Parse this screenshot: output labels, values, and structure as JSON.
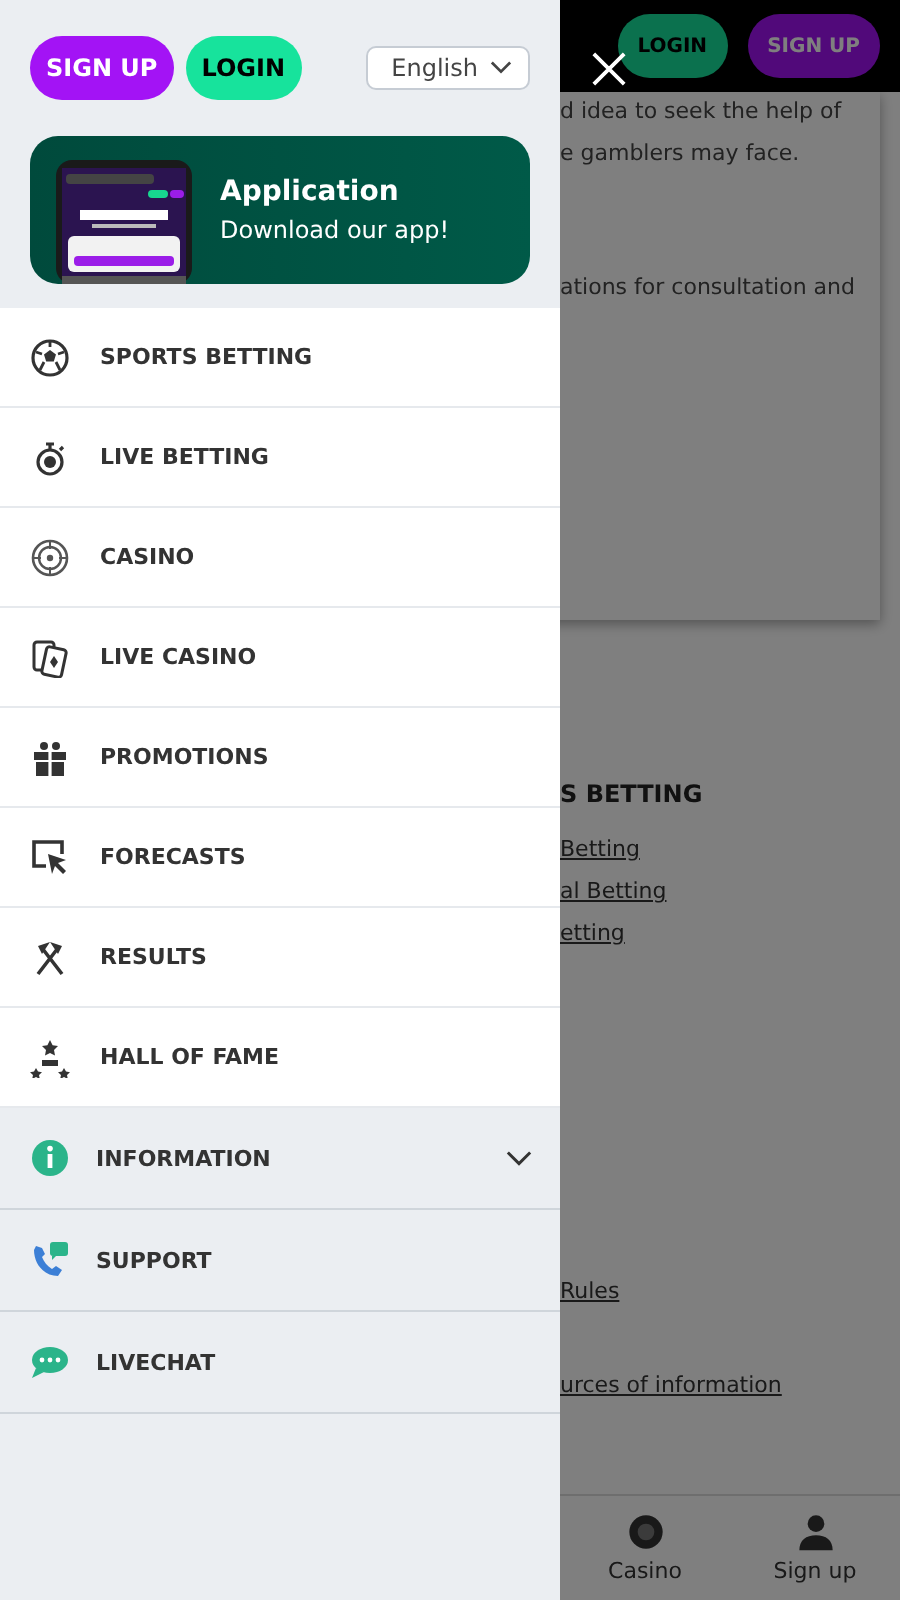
{
  "background_page": {
    "header_buttons": [
      {
        "label": "LOGIN",
        "kind": "login"
      },
      {
        "label": "SIGN UP",
        "kind": "signup"
      }
    ],
    "card_lines": [
      "d idea to seek the help of",
      "e gamblers may face.",
      "ations for consultation and"
    ],
    "section_title": "S BETTING",
    "links": [
      "Betting",
      "al Betting",
      "etting"
    ],
    "lower_links": [
      "Rules",
      "urces of information"
    ],
    "bottom_nav": [
      {
        "label": "Casino",
        "kind": "chip"
      },
      {
        "label": "Sign up",
        "kind": "user"
      }
    ]
  },
  "drawer": {
    "buttons": [
      {
        "label": "SIGN UP",
        "kind": "signup"
      },
      {
        "label": "LOGIN",
        "kind": "login"
      }
    ],
    "language": "English",
    "app_banner": {
      "title": "Application",
      "subtitle": "Download our app!"
    },
    "menu": [
      {
        "label": "SPORTS BETTING",
        "kind": "ball"
      },
      {
        "label": "LIVE BETTING",
        "kind": "stopwatch"
      },
      {
        "label": "CASINO",
        "kind": "roulette"
      },
      {
        "label": "LIVE CASINO",
        "kind": "cards"
      },
      {
        "label": "PROMOTIONS",
        "kind": "gift"
      },
      {
        "label": "FORECASTS",
        "kind": "cursor"
      },
      {
        "label": "RESULTS",
        "kind": "hammers"
      },
      {
        "label": "HALL OF FAME",
        "kind": "podium"
      }
    ],
    "info_menu": [
      {
        "label": "INFORMATION",
        "kind": "info",
        "expanded": false
      },
      {
        "label": "SUPPORT",
        "kind": "phone"
      },
      {
        "label": "LIVECHAT",
        "kind": "chat"
      }
    ]
  }
}
